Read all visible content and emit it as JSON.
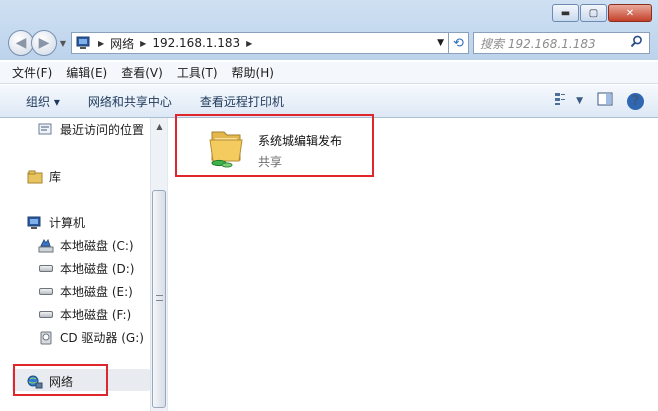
{
  "window": {
    "minimize_label": "▬",
    "maximize_label": "▢",
    "close_label": "✕"
  },
  "address": {
    "segments": [
      "网络",
      "192.168.1.183"
    ],
    "search_placeholder": "搜索 192.168.1.183"
  },
  "menu": {
    "items": [
      "文件(F)",
      "编辑(E)",
      "查看(V)",
      "工具(T)",
      "帮助(H)"
    ]
  },
  "toolbar": {
    "organize": "组织 ▾",
    "network_center": "网络和共享中心",
    "remote_printers": "查看远程打印机",
    "help": "?"
  },
  "sidebar": {
    "recent": "最近访问的位置",
    "library": "库",
    "computer": "计算机",
    "drives": [
      "本地磁盘 (C:)",
      "本地磁盘 (D:)",
      "本地磁盘 (E:)",
      "本地磁盘 (F:)",
      "CD 驱动器 (G:)"
    ],
    "network": "网络"
  },
  "content": {
    "share_name": "系统城编辑发布",
    "share_type": "共享"
  },
  "colors": {
    "highlight": "#e0252b",
    "chrome": "#cfe0f2"
  }
}
